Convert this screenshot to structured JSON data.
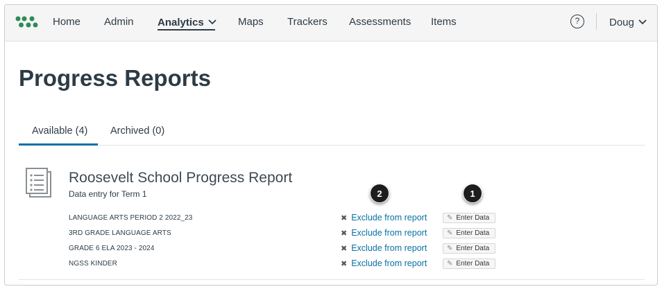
{
  "nav": {
    "items": [
      {
        "label": "Home"
      },
      {
        "label": "Admin"
      },
      {
        "label": "Analytics"
      },
      {
        "label": "Maps"
      },
      {
        "label": "Trackers"
      },
      {
        "label": "Assessments"
      },
      {
        "label": "Items"
      }
    ],
    "active": "Analytics",
    "help_symbol": "?",
    "user_label": "Doug",
    "icons": [
      "logo-icon",
      "chevron-down-icon",
      "help-icon"
    ]
  },
  "page": {
    "title": "Progress Reports"
  },
  "tabs": [
    {
      "label": "Available (4)",
      "selected": true
    },
    {
      "label": "Archived (0)",
      "selected": false
    }
  ],
  "report": {
    "title": "Roosevelt School Progress Report",
    "subtitle": "Data entry for Term 1",
    "exclude_label": "Exclude from report",
    "enter_label": "Enter Data",
    "rows": [
      {
        "name": "LANGUAGE ARTS PERIOD 2 2022_23"
      },
      {
        "name": "3RD GRADE LANGUAGE ARTS"
      },
      {
        "name": "GRADE 6 ELA 2023 - 2024"
      },
      {
        "name": "NGSS KINDER"
      }
    ]
  },
  "callouts": {
    "enter_data": "1",
    "exclude": "2"
  },
  "colors": {
    "link": "#0770a3",
    "logo": "#2e8b57",
    "text": "#2d3b45"
  }
}
